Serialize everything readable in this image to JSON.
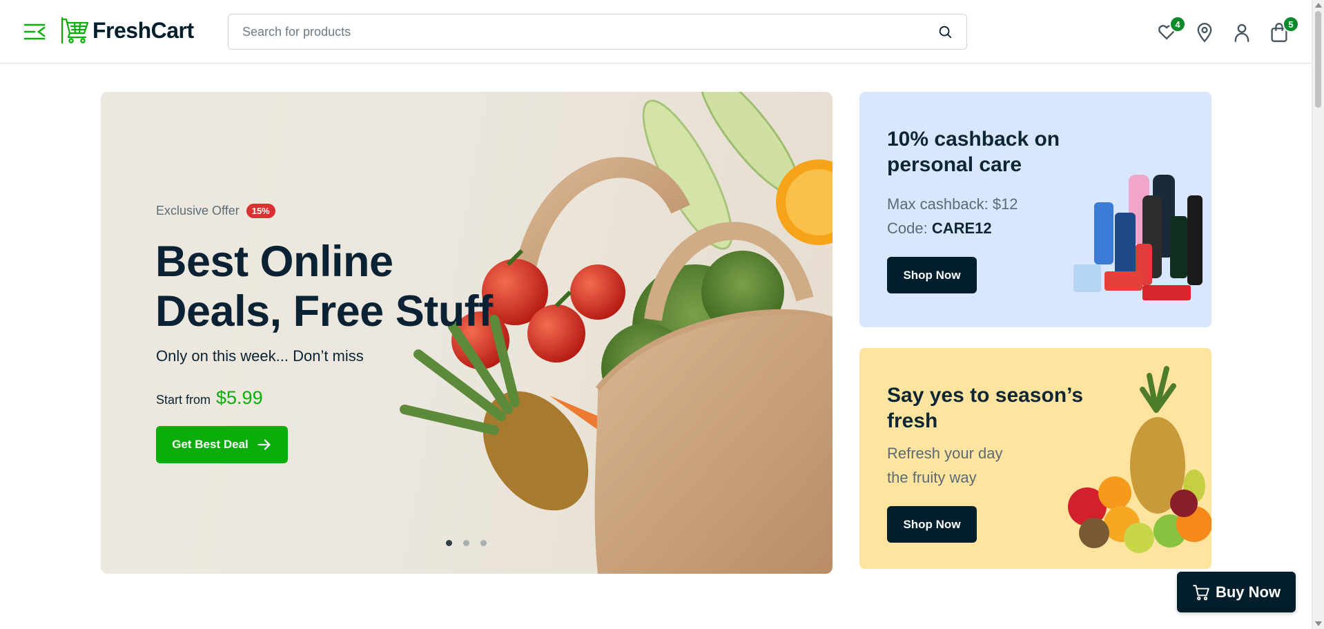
{
  "header": {
    "brand": "FreshCart",
    "search_placeholder": "Search for products",
    "wishlist_count": "4",
    "cart_count": "5"
  },
  "hero": {
    "offer_label": "Exclusive Offer",
    "offer_badge": "15%",
    "title_line1": "Best Online",
    "title_line2": "Deals, Free Stuff",
    "subtitle": "Only on this week... Don’t miss",
    "price_label": "Start from",
    "price": "$5.99",
    "button_label": "Get Best Deal",
    "slides": 3,
    "active_slide": 1
  },
  "promos": [
    {
      "title": "10% cashback on personal care",
      "line1": "Max cashback: $12",
      "code_label": "Code:",
      "code": "CARE12",
      "button_label": "Shop Now"
    },
    {
      "title": "Say yes to season’s fresh",
      "line1": "Refresh your day",
      "line2": "the fruity way",
      "button_label": "Shop Now"
    }
  ],
  "floating": {
    "buy_now_label": "Buy Now"
  },
  "colors": {
    "brand_green": "#0aad0a",
    "dark": "#001e2b",
    "promo_blue": "#d9e7fe",
    "promo_yellow": "#fee49e",
    "badge_red": "#db3030"
  },
  "icons": [
    "menu-icon",
    "cart-logo-icon",
    "search-icon",
    "heart-icon",
    "location-icon",
    "user-icon",
    "bag-icon",
    "arrow-right-icon",
    "cart-icon"
  ]
}
